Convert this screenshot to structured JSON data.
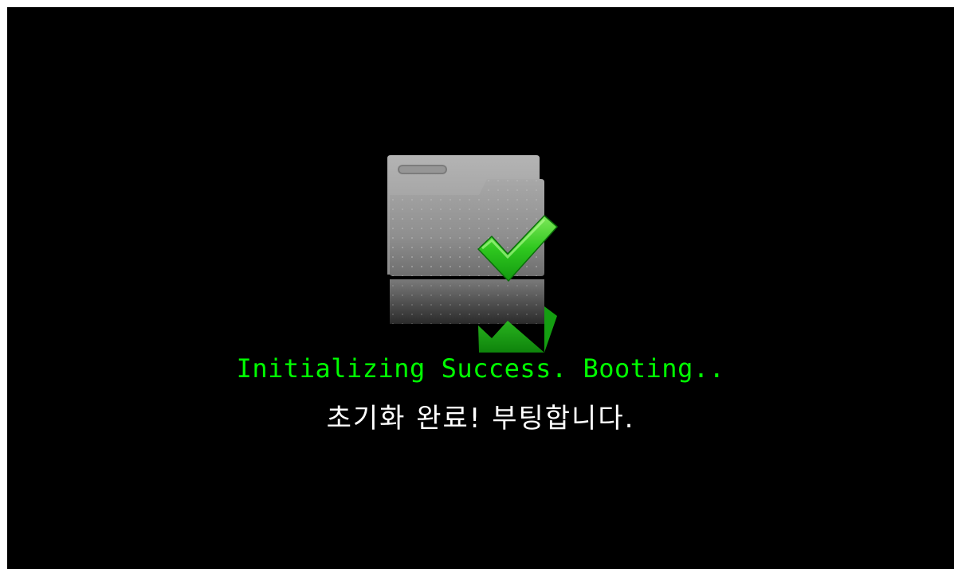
{
  "screen": {
    "background": "#000000",
    "icon": "folder-check-icon",
    "status_en": "Initializing Success. Booting..",
    "status_ko": "초기화 완료! 부팅합니다.",
    "status_en_color": "#00ff00",
    "status_ko_color": "#ffffff"
  }
}
